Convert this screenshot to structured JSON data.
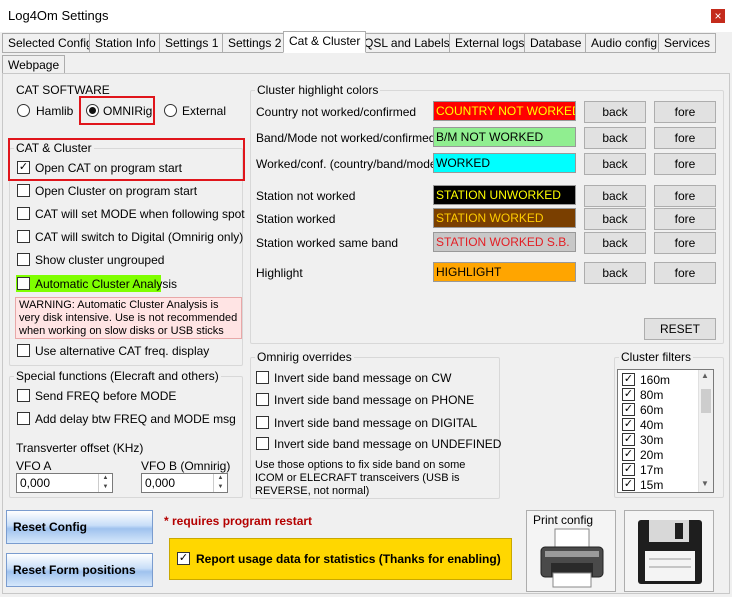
{
  "window": {
    "title": "Log4Om Settings",
    "close_glyph": "×"
  },
  "tabs": [
    {
      "label": "Selected Config"
    },
    {
      "label": "Station Info"
    },
    {
      "label": "Settings 1"
    },
    {
      "label": "Settings 2"
    },
    {
      "label": "Cat & Cluster"
    },
    {
      "label": "QSL and Labels"
    },
    {
      "label": "External logs"
    },
    {
      "label": "Database"
    },
    {
      "label": "Audio config"
    },
    {
      "label": "Services"
    },
    {
      "label": "Webpage"
    }
  ],
  "active_tab": "Cat & Cluster",
  "cat_software": {
    "title": "CAT SOFTWARE",
    "options": [
      {
        "label": "Hamlib",
        "selected": false
      },
      {
        "label": "OMNIRig",
        "selected": true
      },
      {
        "label": "External",
        "selected": false
      }
    ]
  },
  "cat_cluster": {
    "title": "CAT & Cluster",
    "checkboxes": [
      {
        "label": "Open CAT on program start",
        "checked": true
      },
      {
        "label": "Open Cluster on program start",
        "checked": false
      },
      {
        "label": "CAT will set MODE when following spot",
        "checked": false
      },
      {
        "label": "CAT will switch to Digital (Omnirig only)",
        "checked": false
      },
      {
        "label": "Show cluster ungrouped",
        "checked": false
      },
      {
        "label": "Automatic Cluster Analysis",
        "checked": false
      }
    ],
    "warning": "WARNING: Automatic Cluster Analysis is very disk intensive. Use is not recommended when working on slow disks or USB sticks",
    "alt_freq": {
      "label": "Use alternative CAT freq. display",
      "checked": false
    }
  },
  "special_functions": {
    "title": "Special functions (Elecraft and others)",
    "checkboxes": [
      {
        "label": "Send FREQ before MODE",
        "checked": false
      },
      {
        "label": "Add delay btw FREQ and MODE msg",
        "checked": false
      }
    ],
    "transverter_label": "Transverter offset (KHz)",
    "vfo_a": {
      "label": "VFO A",
      "value": "0,000"
    },
    "vfo_b": {
      "label": "VFO B (Omnirig)",
      "value": "0,000"
    }
  },
  "highlight_colors": {
    "title": "Cluster highlight colors",
    "back_label": "back",
    "fore_label": "fore",
    "reset_label": "RESET",
    "rows": [
      {
        "label": "Country not worked/confirmed",
        "sample": "COUNTRY NOT WORKED",
        "bg": "#ff0000",
        "fg": "#ffff00"
      },
      {
        "label": "Band/Mode not worked/confirmed",
        "sample": "B/M NOT WORKED",
        "bg": "#90ee90",
        "fg": "#000000"
      },
      {
        "label": "Worked/conf. (country/band/mode)",
        "sample": "WORKED",
        "bg": "#00ffff",
        "fg": "#000000"
      },
      {
        "label": "Station not worked",
        "sample": "STATION UNWORKED",
        "bg": "#000000",
        "fg": "#ffff00"
      },
      {
        "label": "Station worked",
        "sample": "STATION WORKED",
        "bg": "#7a3f00",
        "fg": "#ffcc00"
      },
      {
        "label": "Station worked same band",
        "sample": "STATION WORKED S.B.",
        "bg": "#c8c8c8",
        "fg": "#e31e24"
      },
      {
        "label": "Highlight",
        "sample": "HIGHLIGHT",
        "bg": "#ffa500",
        "fg": "#000000"
      }
    ]
  },
  "omnirig_overrides": {
    "title": "Omnirig overrides",
    "checkboxes": [
      {
        "label": "Invert side band message on CW",
        "checked": false
      },
      {
        "label": "Invert side band message on PHONE",
        "checked": false
      },
      {
        "label": "Invert side band message on DIGITAL",
        "checked": false
      },
      {
        "label": "Invert side band message on UNDEFINED",
        "checked": false
      }
    ],
    "note": "Use those options to fix side band on some ICOM or ELECRAFT transceivers (USB is REVERSE, not normal)"
  },
  "cluster_filters": {
    "title": "Cluster filters",
    "items": [
      {
        "label": "160m",
        "checked": true
      },
      {
        "label": "80m",
        "checked": true
      },
      {
        "label": "60m",
        "checked": true
      },
      {
        "label": "40m",
        "checked": true
      },
      {
        "label": "30m",
        "checked": true
      },
      {
        "label": "20m",
        "checked": true
      },
      {
        "label": "17m",
        "checked": true
      },
      {
        "label": "15m",
        "checked": true
      }
    ]
  },
  "footer": {
    "reset_config": "Reset Config",
    "reset_form": "Reset Form positions",
    "restart_note": "* requires program restart",
    "report_usage": {
      "label": "Report usage data for statistics (Thanks for enabling)",
      "checked": true
    },
    "print_config": "Print config"
  },
  "colors": {
    "red_highlight": "#e0151b",
    "warning_bg": "#ffe4e4",
    "auto_cluster_bg": "#7fff00",
    "report_bg": "#ffd700"
  }
}
